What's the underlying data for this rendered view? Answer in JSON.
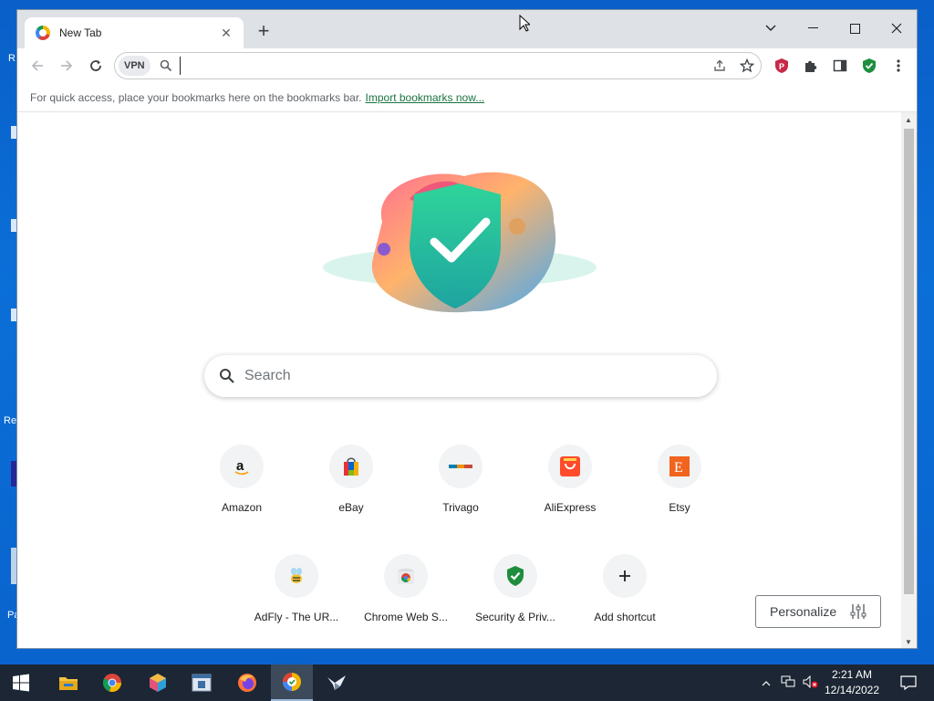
{
  "desktop": {
    "edge_labels": [
      "R",
      "Re",
      "Pa"
    ]
  },
  "browser": {
    "tab": {
      "title": "New Tab"
    },
    "window_controls": {
      "tab_search": "⌄",
      "minimize": "—",
      "maximize": "☐",
      "close": "✕"
    },
    "omnibox": {
      "vpn_label": "VPN",
      "value": "",
      "placeholder": ""
    },
    "bookmarks_bar": {
      "message": "For quick access, place your bookmarks here on the bookmarks bar.",
      "import_link": "Import bookmarks now..."
    }
  },
  "new_tab_page": {
    "search_placeholder": "Search",
    "shortcuts_row1": [
      {
        "label": "Amazon",
        "icon": "amazon-icon"
      },
      {
        "label": "eBay",
        "icon": "ebay-icon"
      },
      {
        "label": "Trivago",
        "icon": "trivago-icon"
      },
      {
        "label": "AliExpress",
        "icon": "aliexpress-icon"
      },
      {
        "label": "Etsy",
        "icon": "etsy-icon"
      }
    ],
    "shortcuts_row2": [
      {
        "label": "AdFly - The UR...",
        "icon": "adfly-icon"
      },
      {
        "label": "Chrome Web S...",
        "icon": "chrome-web-store-icon"
      },
      {
        "label": "Security & Priv...",
        "icon": "shield-check-icon"
      },
      {
        "label": "Add shortcut",
        "icon": "plus-icon"
      }
    ],
    "personalize_label": "Personalize"
  },
  "colors": {
    "accent_green": "#1a7340",
    "shield_green": "#1e8e3e",
    "taskbar": "#1c2634",
    "desktop_blue": "#0b6fd8"
  },
  "taskbar": {
    "pinned": [
      "windows-start-icon",
      "file-explorer-icon",
      "chrome-icon",
      "cube-app-icon",
      "app-window-icon",
      "firefox-icon",
      "secure-browser-icon",
      "bird-app-icon"
    ],
    "clock_time": "2:21 AM",
    "clock_date": "12/14/2022"
  }
}
